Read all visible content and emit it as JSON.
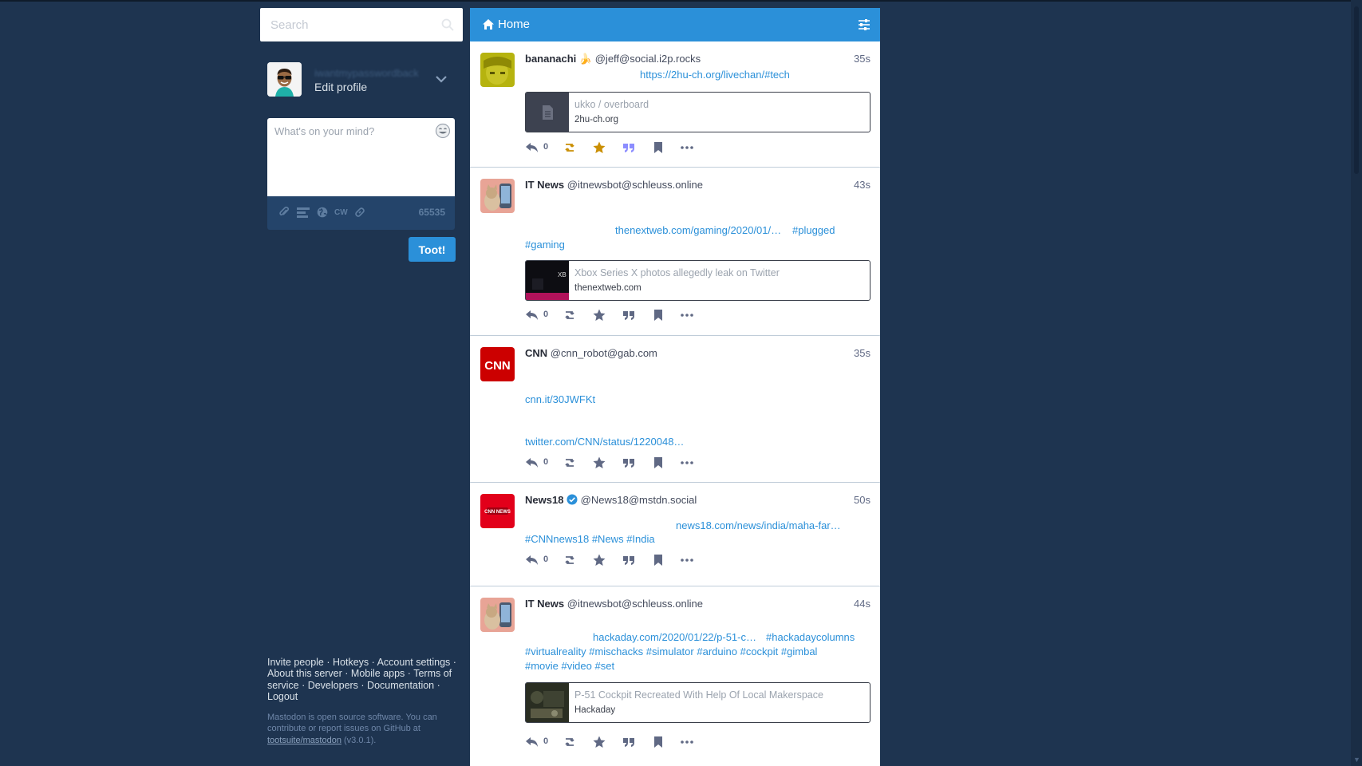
{
  "search": {
    "placeholder": "Search"
  },
  "account": {
    "display_name": "iwantmypasswordback",
    "edit_profile": "Edit profile"
  },
  "compose": {
    "placeholder": "What's on your mind?",
    "cw_label": "CW",
    "char_count": "65535",
    "toot_label": "Toot!"
  },
  "footer_links": {
    "invite": "Invite people",
    "hotkeys": "Hotkeys",
    "account_settings": "Account settings",
    "about": "About this server",
    "mobile": "Mobile apps",
    "terms": "Terms of service",
    "developers": "Developers",
    "documentation": "Documentation",
    "logout": "Logout"
  },
  "footer_note": {
    "text": "Mastodon is open source software. You can contribute or report issues on GitHub at",
    "repo": "tootsuite/mastodon",
    "version": "(v3.0.1)."
  },
  "column": {
    "title": "Home"
  },
  "colors": {
    "accent": "#2b90d9",
    "background": "#1e3450",
    "star_active": "#ca8f04"
  },
  "statuses": [
    {
      "name": "bananachi",
      "emoji": "🍌",
      "acct": "@jeff@social.i2p.rocks",
      "time": "35s",
      "link": "https://2hu-ch.org/livechan/#tech",
      "card": {
        "title": "ukko / overboard",
        "host": "2hu-ch.org"
      },
      "reply_count": "0",
      "favourited": true
    },
    {
      "name": "IT News",
      "acct": "@itnewsbot@schleuss.online",
      "time": "43s",
      "link": "thenextweb.com/gaming/2020/01/…",
      "tags_line1": [
        "#plugged"
      ],
      "tags_line2": [
        "#gaming"
      ],
      "card": {
        "title": "Xbox Series X photos allegedly leak on Twitter",
        "host": "thenextweb.com"
      },
      "reply_count": "0",
      "favourited": false
    },
    {
      "name": "CNN",
      "acct": "@cnn_robot@gab.com",
      "time": "35s",
      "link1": "cnn.it/30JWFKt",
      "link2": "twitter.com/CNN/status/1220048…",
      "reply_count": "0",
      "favourited": false
    },
    {
      "name": "News18",
      "verified": true,
      "acct": "@News18@mstdn.social",
      "time": "50s",
      "link": "news18.com/news/india/maha-far…",
      "tags": [
        "#CNNnews18",
        "#News",
        "#India"
      ],
      "reply_count": "0",
      "favourited": false
    },
    {
      "name": "IT News",
      "acct": "@itnewsbot@schleuss.online",
      "time": "44s",
      "link": "hackaday.com/2020/01/22/p-51-c…",
      "tags_line1": [
        "#hackadaycolumns"
      ],
      "tags_line2": [
        "#virtualreality",
        "#mischacks",
        "#simulator",
        "#arduino",
        "#cockpit",
        "#gimbal"
      ],
      "tags_line3": [
        "#movie",
        "#video",
        "#set"
      ],
      "card": {
        "title": "P-51 Cockpit Recreated With Help Of Local Makerspace",
        "host": "Hackaday"
      },
      "reply_count": "0",
      "favourited": false
    }
  ]
}
